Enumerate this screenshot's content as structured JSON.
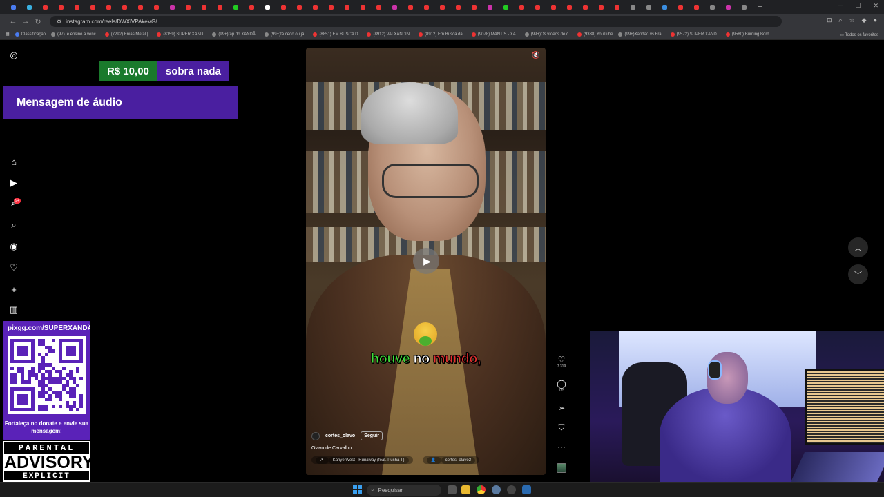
{
  "browser": {
    "url": "instagram.com/reels/DWXiVPAkeVG/",
    "tab_colors": [
      "#4a7cf0",
      "#3ab0e0",
      "#e33",
      "#e33",
      "#e33",
      "#e33",
      "#e33",
      "#e33",
      "#e33",
      "#e33",
      "#c3a",
      "#e33",
      "#e33",
      "#e33",
      "#2c2",
      "#e33",
      "#fff",
      "#e33",
      "#e33",
      "#e33",
      "#e33",
      "#e33",
      "#e33",
      "#e33",
      "#c3a",
      "#e33",
      "#e33",
      "#e33",
      "#e33",
      "#e33",
      "#c3a",
      "#2c2",
      "#e33",
      "#e33",
      "#e33",
      "#e33",
      "#e33",
      "#e33",
      "#e33",
      "#888",
      "#888",
      "#3a8ee0",
      "#e33",
      "#e33",
      "#888",
      "#c3a",
      "#888"
    ],
    "bookmarks": [
      {
        "label": "Classificação",
        "color": "#4a7cf0"
      },
      {
        "label": "(97)Te ensino a venc...",
        "color": "#888"
      },
      {
        "label": "(7292) Enias Metal |...",
        "color": "#e33"
      },
      {
        "label": "(8159) SUPER XAND...",
        "color": "#e33"
      },
      {
        "label": "(99+)rap do XANDÃ...",
        "color": "#888"
      },
      {
        "label": "(99+)tá cedo ou já...",
        "color": "#888"
      },
      {
        "label": "(8851) EM BUSCA D...",
        "color": "#e33"
      },
      {
        "label": "(8912) VAI XANDIN...",
        "color": "#e33"
      },
      {
        "label": "(8912) Em Busca da...",
        "color": "#e33"
      },
      {
        "label": "(9078) MANTIS - XA...",
        "color": "#e33"
      },
      {
        "label": "(99+)Os vídeos de c...",
        "color": "#888"
      },
      {
        "label": "(9338) YouTube",
        "color": "#e33"
      },
      {
        "label": "(99+)Xandão vs Fra...",
        "color": "#888"
      },
      {
        "label": "(9572) SUPER XAND...",
        "color": "#e33"
      },
      {
        "label": "(9580) Burning Bord...",
        "color": "#e33"
      }
    ],
    "all_bookmarks_label": "Todos os favoritos"
  },
  "overlay": {
    "donation_amount": "R$ 10,00",
    "donation_text": "sobra nada",
    "audio_message": "Mensagem de áudio",
    "pix_url": "pixgg.com/SUPERXANDÃO",
    "pix_text": "Fortaleça no donate e envie sua mensagem!",
    "advisory_top": "PARENTAL",
    "advisory_mid": "ADVISORY",
    "advisory_bottom": "EXPLICIT CONTENT"
  },
  "sidebar": {
    "notification_badge": "9+"
  },
  "reel": {
    "caption_words": [
      "houve",
      "no",
      "mundo,"
    ],
    "author": "cortes_olavo",
    "follow_label": "Seguir",
    "description": "Olavo de Carvalho .",
    "music": "Kanye West · Runaway (feat. Pusha T)",
    "audio_user": "cortes_olavo2",
    "likes": "7.319",
    "comments": "185"
  },
  "taskbar": {
    "search_placeholder": "Pesquisar"
  }
}
